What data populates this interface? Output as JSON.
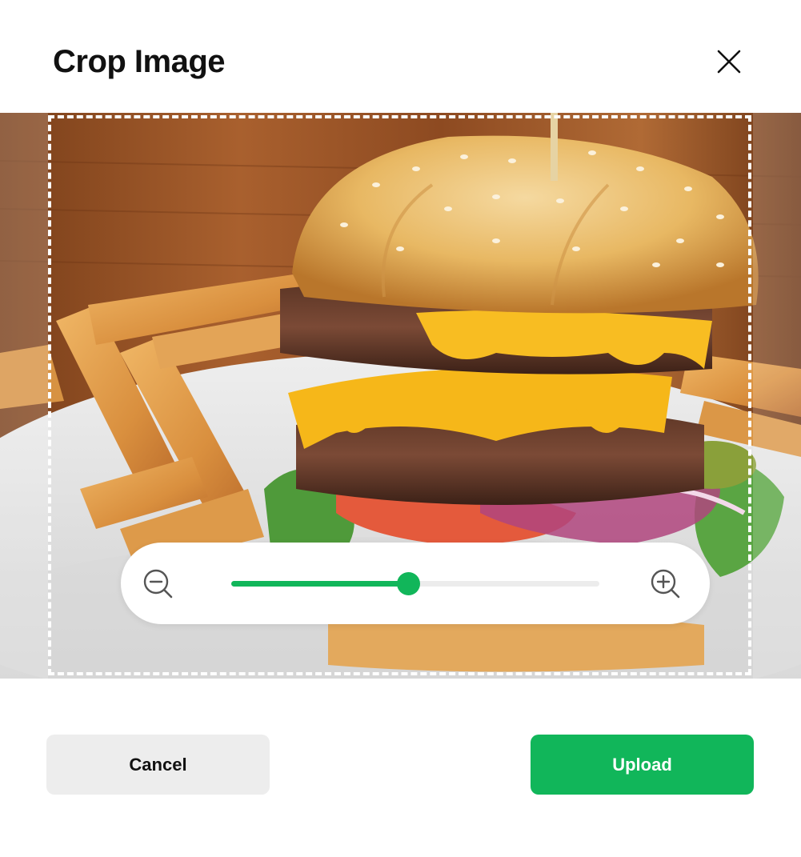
{
  "dialog": {
    "title": "Crop Image"
  },
  "image": {
    "subject": "burger-with-fries-photo"
  },
  "zoom": {
    "level": 0.48,
    "out_icon": "zoom-out-icon",
    "in_icon": "zoom-in-icon"
  },
  "actions": {
    "cancel_label": "Cancel",
    "upload_label": "Upload"
  },
  "colors": {
    "accent": "#11b65a",
    "secondary_button": "#ededed",
    "title_text": "#111111"
  }
}
